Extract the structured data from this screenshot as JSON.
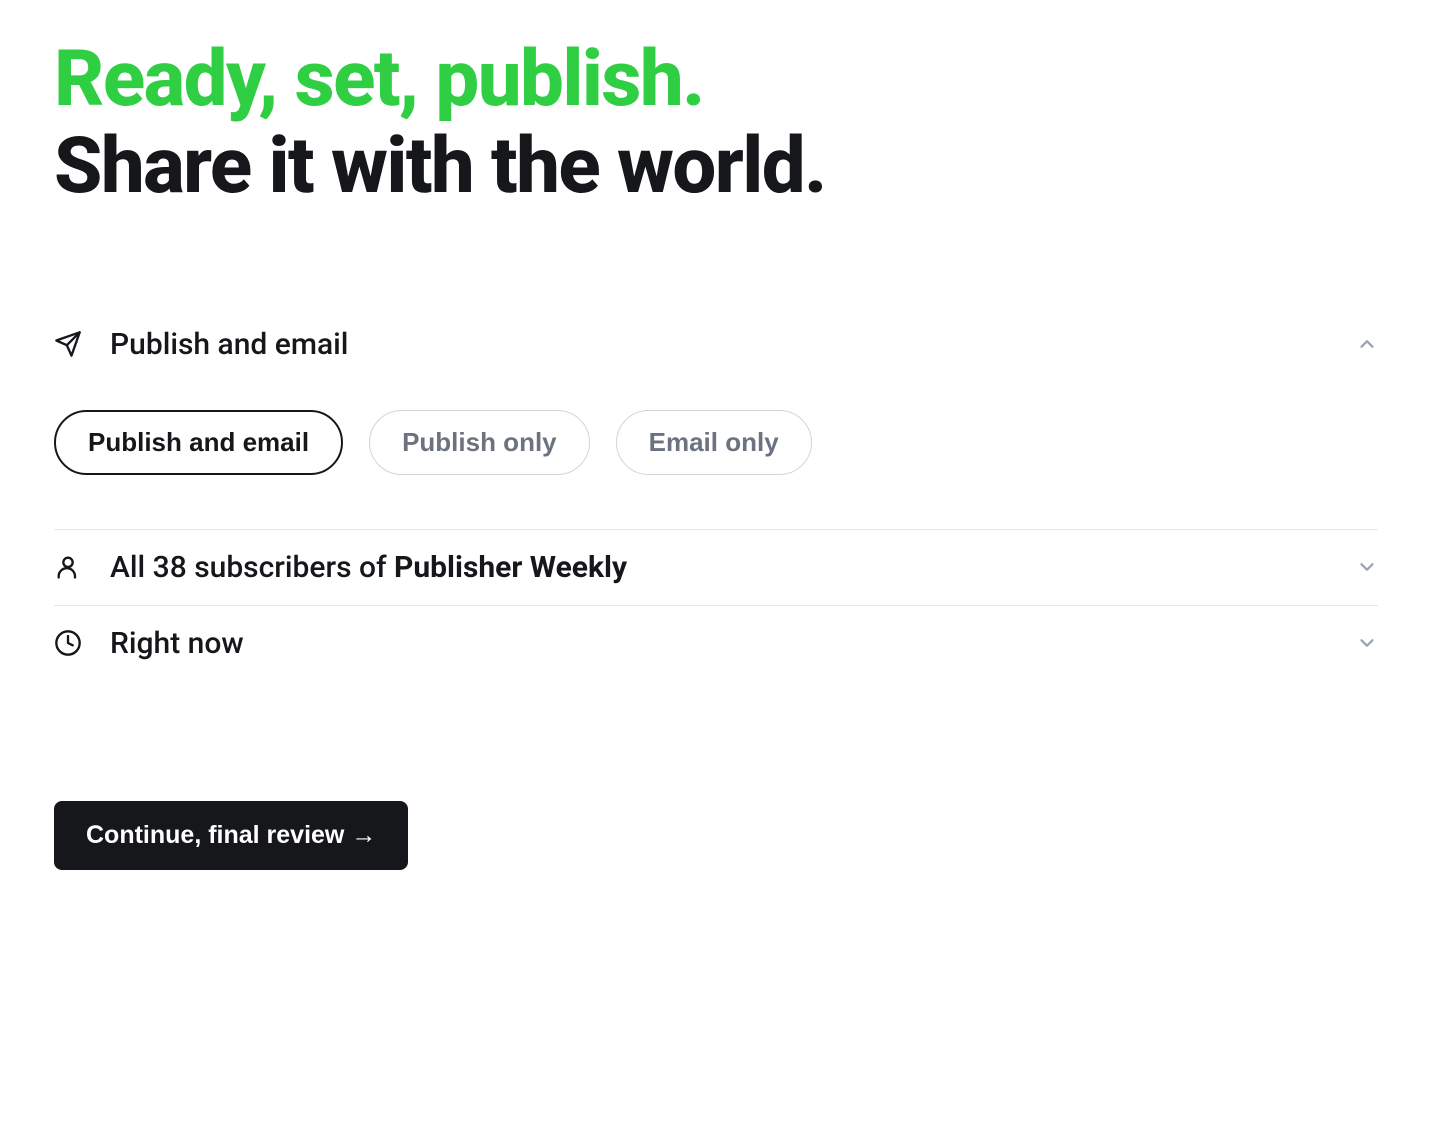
{
  "hero": {
    "line1": "Ready, set, publish.",
    "line2": "Share it with the world."
  },
  "sections": {
    "publish": {
      "title": "Publish and email",
      "options": [
        "Publish and email",
        "Publish only",
        "Email only"
      ],
      "selected_index": 0
    },
    "audience": {
      "prefix": "All 38 subscribers of ",
      "name": "Publisher Weekly"
    },
    "schedule": {
      "label": "Right now"
    }
  },
  "cta": {
    "label": "Continue, final review →"
  }
}
